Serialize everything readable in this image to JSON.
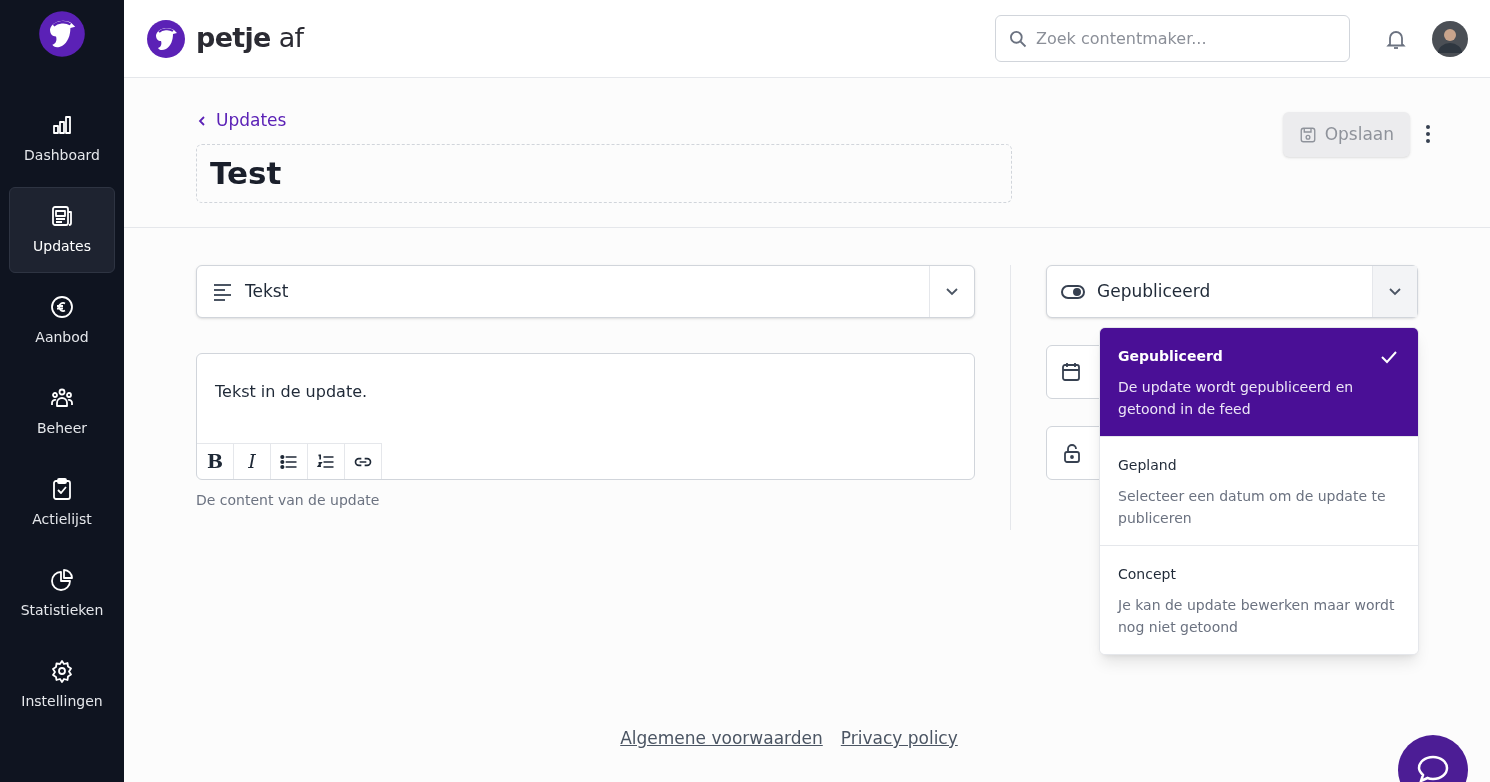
{
  "sidebar": {
    "items": [
      {
        "label": "Dashboard",
        "selected": false
      },
      {
        "label": "Updates",
        "selected": true
      },
      {
        "label": "Aanbod",
        "selected": false
      },
      {
        "label": "Beheer",
        "selected": false
      },
      {
        "label": "Actielijst",
        "selected": false
      },
      {
        "label": "Statistieken",
        "selected": false
      },
      {
        "label": "Instellingen",
        "selected": false
      }
    ]
  },
  "header": {
    "brand": {
      "bold": "petje",
      "light": "af"
    },
    "search": {
      "placeholder": "Zoek contentmaker..."
    }
  },
  "page": {
    "back_link": "Updates",
    "title": "Test",
    "save_button": {
      "label": "Opslaan",
      "disabled": true
    }
  },
  "editor": {
    "type_select": "Tekst",
    "content": "Tekst in de update.",
    "toolbar": [
      "B",
      "I"
    ],
    "help": "De content van de update"
  },
  "status": {
    "select": "Gepubliceerd",
    "options": [
      {
        "label": "Gepubliceerd",
        "description": "De update wordt gepubliceerd en getoond in de feed",
        "selected": true
      },
      {
        "label": "Gepland",
        "description": "Selecteer een datum om de update te publiceren",
        "selected": false
      },
      {
        "label": "Concept",
        "description": "Je kan de update bewerken maar wordt nog niet getoond",
        "selected": false
      }
    ]
  },
  "footer": {
    "links": [
      "Algemene voorwaarden",
      "Privacy policy"
    ]
  }
}
